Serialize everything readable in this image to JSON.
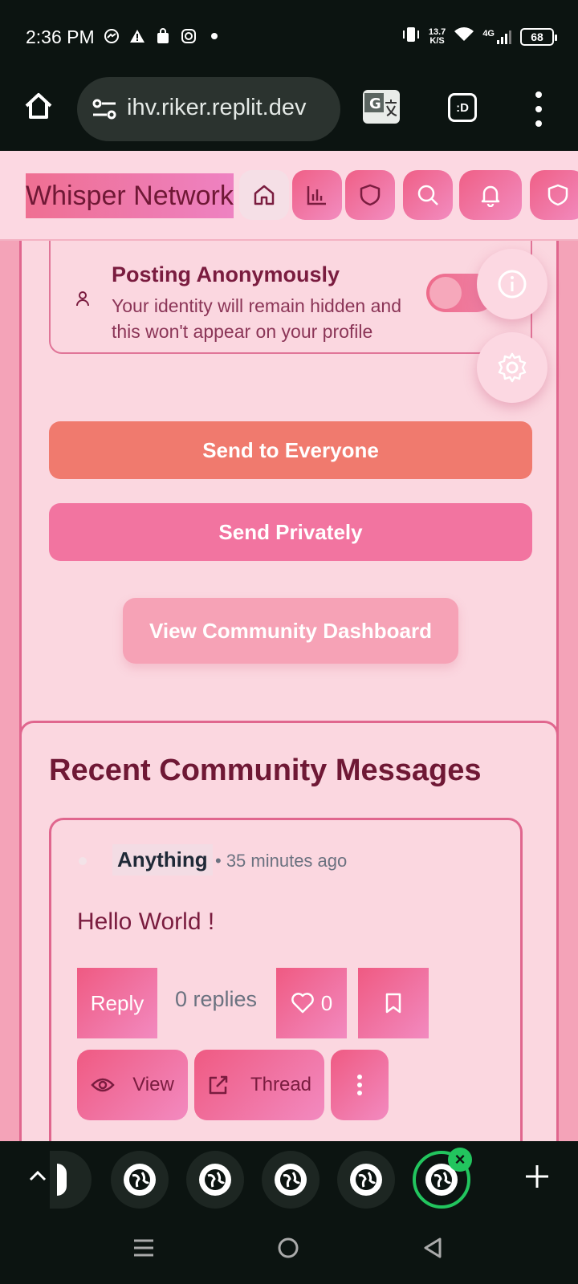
{
  "status_bar": {
    "time": "2:36 PM",
    "speed_value": "13.7",
    "speed_unit": "K/S",
    "network": "4G",
    "battery": "68"
  },
  "browser": {
    "url": "ihv.riker.replit.dev",
    "tabs_label": ":D"
  },
  "site_header": {
    "logo": "Whisper Network"
  },
  "anon_section": {
    "title": "Posting Anonymously",
    "description": "Your identity will remain hidden and this won't appear on your profile",
    "toggle_on": true
  },
  "actions": {
    "send_everyone": "Send to Everyone",
    "send_private": "Send Privately",
    "dashboard": "View Community Dashboard"
  },
  "recent": {
    "title": "Recent Community Messages",
    "messages": [
      {
        "author": "Anything",
        "time": "• 35 minutes ago",
        "body": "Hello World !",
        "reply_label": "Reply",
        "replies": "0 replies",
        "likes": "0",
        "view_label": "View",
        "thread_label": "Thread"
      }
    ]
  },
  "colors": {
    "accent_pink": "#ef5a82",
    "send_everyone": "#f07a6e",
    "send_private": "#f274a0",
    "heading": "#6f1835",
    "tab_active": "#22c55e"
  }
}
